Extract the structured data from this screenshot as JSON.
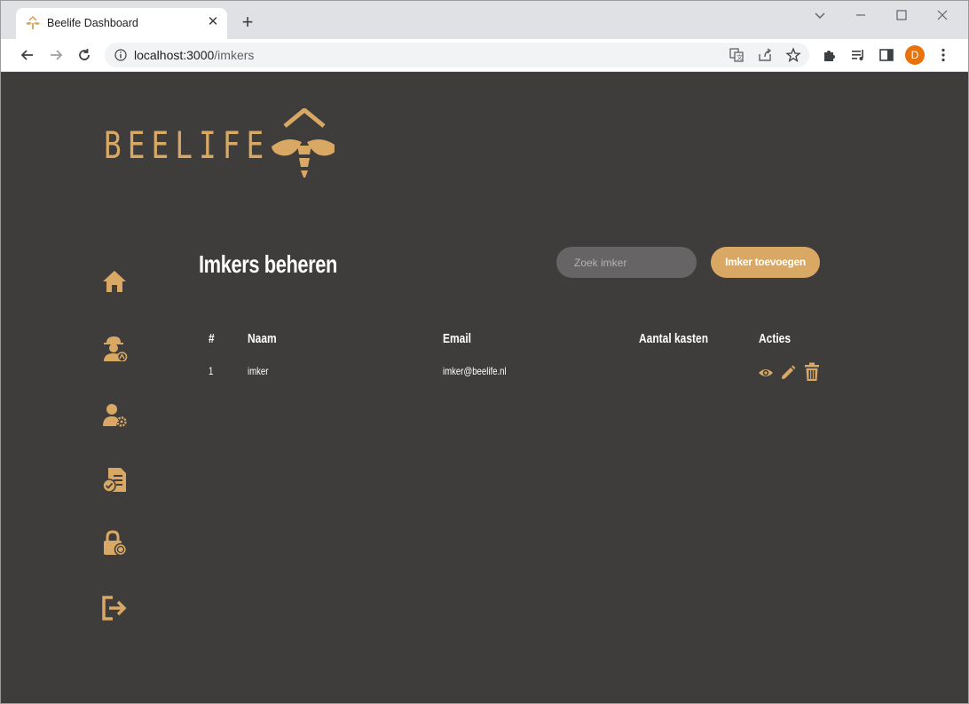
{
  "browser": {
    "tab_title": "Beelife Dashboard",
    "url_host": "localhost:3000",
    "url_path": "/imkers",
    "profile_initial": "D"
  },
  "brand": {
    "logo_text": "BEELIFE",
    "accent": "#d8a864",
    "background": "#3f3d3b"
  },
  "sidebar": {
    "items": [
      {
        "icon": "home-icon"
      },
      {
        "icon": "beekeeper-icon"
      },
      {
        "icon": "user-settings-icon"
      },
      {
        "icon": "document-check-icon"
      },
      {
        "icon": "lock-icon"
      },
      {
        "icon": "logout-icon"
      }
    ]
  },
  "main": {
    "title": "Imkers beheren",
    "search_placeholder": "Zoek imker",
    "add_button_label": "Imker toevoegen"
  },
  "table": {
    "headers": [
      "#",
      "Naam",
      "Email",
      "Aantal kasten",
      "Acties"
    ],
    "rows": [
      {
        "id": "1",
        "naam": "imker",
        "email": "imker@beelife.nl",
        "aantal_kasten": ""
      }
    ],
    "actions": [
      "view-icon",
      "edit-icon",
      "delete-icon"
    ]
  }
}
